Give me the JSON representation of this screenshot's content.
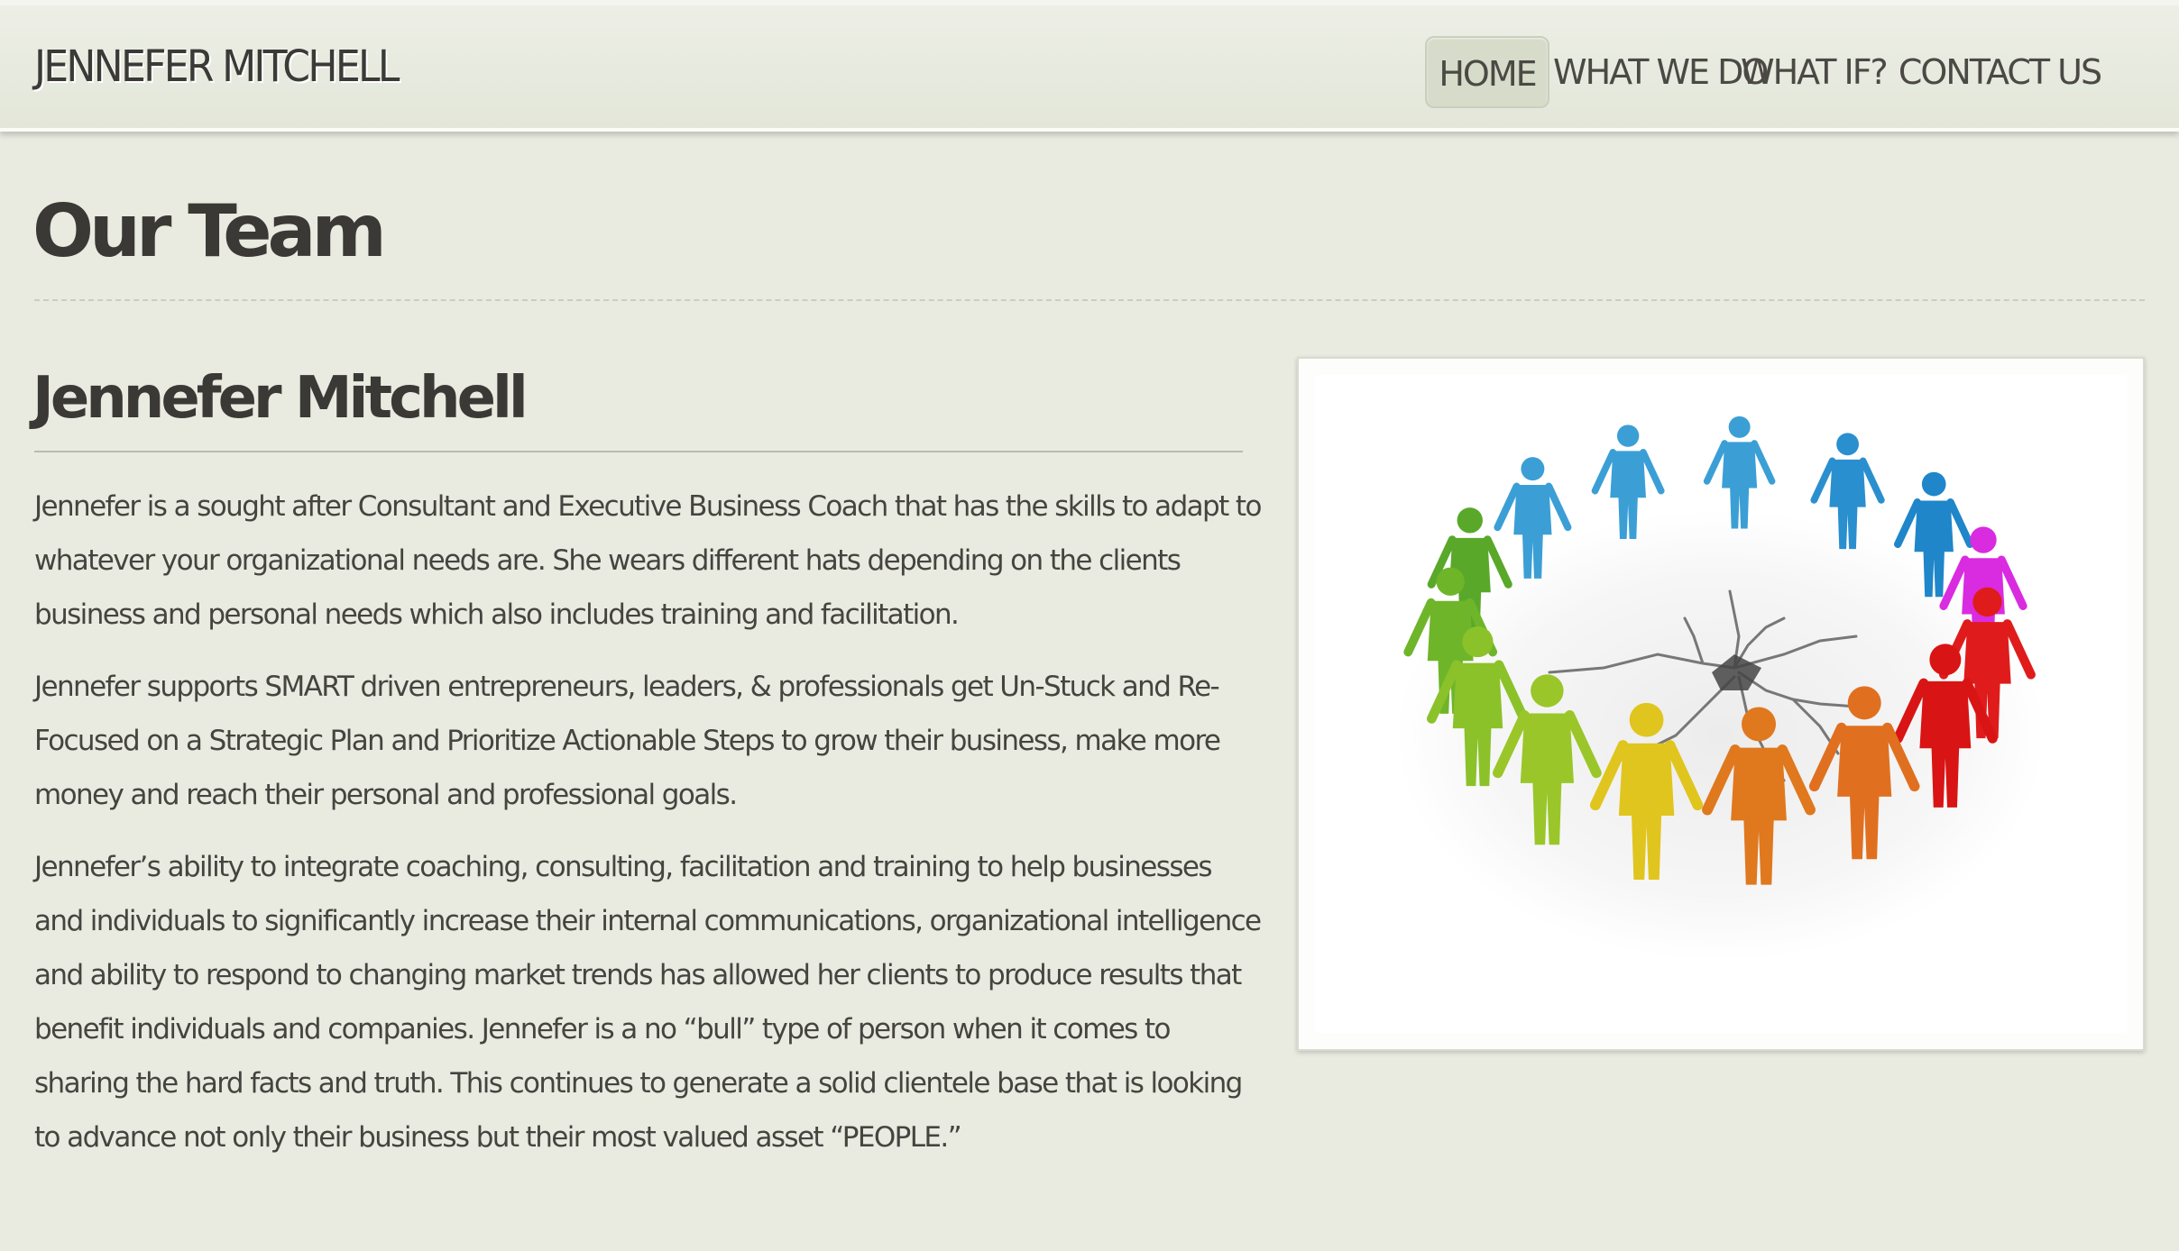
{
  "header": {
    "site_title": "JENNEFER MITCHELL",
    "nav": [
      {
        "label": "HOME",
        "active": true
      },
      {
        "label": "WHAT WE DO",
        "active": false
      },
      {
        "label": "WHAT IF?",
        "active": false
      },
      {
        "label": "CONTACT US",
        "active": false
      }
    ]
  },
  "main": {
    "page_title": "Our Team",
    "section_heading": "Jennefer Mitchell",
    "paragraphs": [
      "Jennefer is a sought after Consultant and Executive Business Coach that has the skills to adapt to whatever your organizational needs are. She wears different hats depending on the clients business and personal needs which also includes training and facilitation.",
      "Jennefer supports SMART driven entrepreneurs, leaders, & professionals get Un-Stuck and Re-Focused on a Strategic Plan and Prioritize Actionable Steps to grow their business, make more money and reach their personal and professional goals.",
      "Jennefer’s ability to integrate coaching, consulting, facilitation and training to help businesses and individuals to significantly increase their internal communications, organizational intelligence and ability to respond to changing market trends has allowed her clients to produce results that benefit individuals and companies. Jennefer is a no “bull” type of person when it comes to sharing the hard facts and truth. This continues to generate a solid clientele base that is looking to advance not only their business but their most valued asset “PEOPLE.”"
    ]
  },
  "image": {
    "figure_colors": [
      "#3b9fd6",
      "#3b9fd6",
      "#2a8fcf",
      "#1f86c9",
      "#d92be0",
      "#e01b1b",
      "#d91414",
      "#e07020",
      "#e0781e",
      "#e0c51e",
      "#9ac62a",
      "#8bc22a",
      "#6fb52a",
      "#5aa82a",
      "#3b9fd6"
    ]
  }
}
